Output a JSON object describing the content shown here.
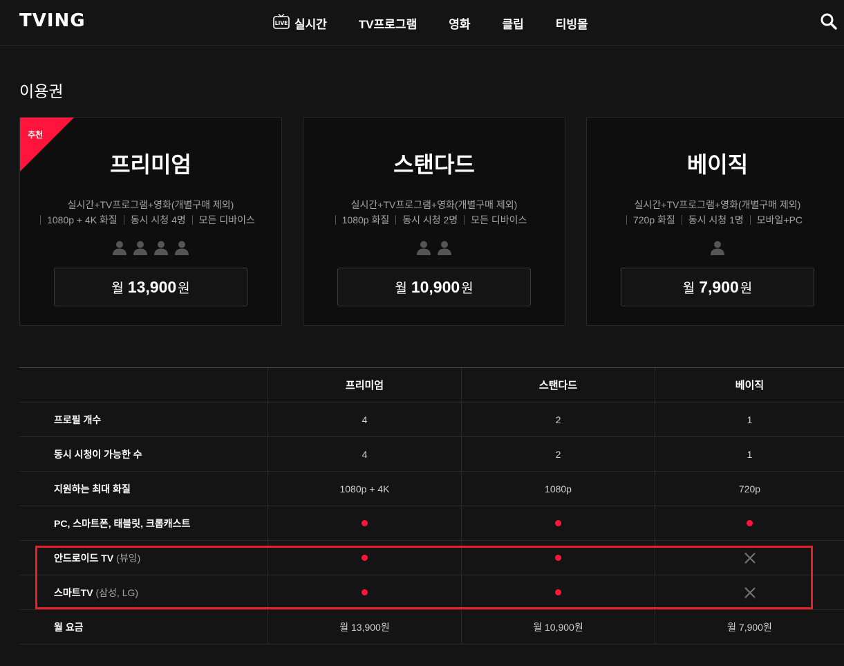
{
  "header": {
    "logo": "TVING",
    "nav": [
      {
        "label": "실시간",
        "icon": "live-tv-icon",
        "icon_text": "LIVE"
      },
      {
        "label": "TV프로그램"
      },
      {
        "label": "영화"
      },
      {
        "label": "클립"
      },
      {
        "label": "티빙몰"
      }
    ]
  },
  "page_title": "이용권",
  "plans": [
    {
      "badge": "추천",
      "name": "프리미엄",
      "desc": "실시간+TV프로그램+영화(개별구매 제외)",
      "features": [
        "1080p + 4K 화질",
        "동시 시청 4명",
        "모든 디바이스"
      ],
      "persons": 4,
      "price_prefix": "월",
      "price": "13,900",
      "price_suffix": "원"
    },
    {
      "name": "스탠다드",
      "desc": "실시간+TV프로그램+영화(개별구매 제외)",
      "features": [
        "1080p 화질",
        "동시 시청 2명",
        "모든 디바이스"
      ],
      "persons": 2,
      "price_prefix": "월",
      "price": "10,900",
      "price_suffix": "원"
    },
    {
      "name": "베이직",
      "desc": "실시간+TV프로그램+영화(개별구매 제외)",
      "features": [
        "720p 화질",
        "동시 시청 1명",
        "모바일+PC"
      ],
      "persons": 1,
      "price_prefix": "월",
      "price": "7,900",
      "price_suffix": "원"
    }
  ],
  "table": {
    "columns": [
      "프리미엄",
      "스탠다드",
      "베이직"
    ],
    "rows": [
      {
        "label": "프로필 개수",
        "note": "",
        "values": [
          "4",
          "2",
          "1"
        ]
      },
      {
        "label": "동시 시청이 가능한 수",
        "note": "",
        "values": [
          "4",
          "2",
          "1"
        ]
      },
      {
        "label": "지원하는 최대 화질",
        "note": "",
        "values": [
          "1080p + 4K",
          "1080p",
          "720p"
        ]
      },
      {
        "label": "PC, 스마트폰, 태블릿, 크롬캐스트",
        "note": "",
        "values": [
          "dot",
          "dot",
          "dot"
        ]
      },
      {
        "label": "안드로이드 TV",
        "note": "(뷰잉)",
        "values": [
          "dot",
          "dot",
          "x"
        ]
      },
      {
        "label": "스마트TV",
        "note": "(삼성, LG)",
        "values": [
          "dot",
          "dot",
          "x"
        ]
      },
      {
        "label": "월 요금",
        "note": "",
        "values": [
          "월 13,900원",
          "월 10,900원",
          "월 7,900원"
        ]
      }
    ]
  },
  "colors": {
    "accent": "#ff153c",
    "highlight": "#e8202a",
    "background": "#141414"
  }
}
